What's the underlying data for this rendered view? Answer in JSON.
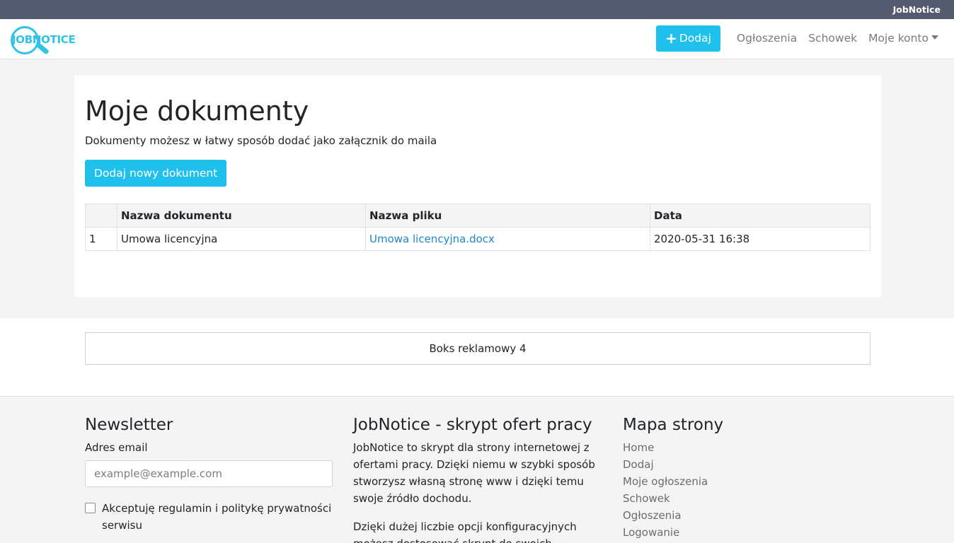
{
  "topbar": {
    "brand": "JobNotice"
  },
  "navbar": {
    "logo_text": "JOBNOTICE",
    "add_label": "Dodaj",
    "links": [
      "Ogłoszenia",
      "Schowek",
      "Moje konto"
    ]
  },
  "main": {
    "title": "Moje dokumenty",
    "subtitle": "Dokumenty możesz w łatwy sposób dodać jako załącznik do maila",
    "new_doc_button": "Dodaj nowy dokument",
    "table": {
      "headers": [
        "",
        "Nazwa dokumentu",
        "Nazwa pliku",
        "Data"
      ],
      "rows": [
        {
          "num": "1",
          "doc_name": "Umowa licencyjna",
          "file_name": "Umowa licencyjna.docx",
          "date": "2020-05-31 16:38"
        }
      ]
    }
  },
  "ad": {
    "label": "Boks reklamowy 4"
  },
  "footer": {
    "newsletter": {
      "title": "Newsletter",
      "email_label": "Adres email",
      "email_placeholder": "example@example.com",
      "consent": "Akceptuję regulamin i politykę prywatności serwisu"
    },
    "about": {
      "title": "JobNotice - skrypt ofert pracy",
      "p1": "JobNotice to skrypt dla strony internetowej z ofertami pracy. Dzięki niemu w szybki sposób stworzysz własną stronę www i dzięki temu swoje źródło dochodu.",
      "p2": "Dzięki dużej liczbie opcji konfiguracyjnych możesz dostosować skrypt do swoich"
    },
    "sitemap": {
      "title": "Mapa strony",
      "links": [
        "Home",
        "Dodaj",
        "Moje ogłoszenia",
        "Schowek",
        "Ogłoszenia",
        "Logowanie"
      ]
    }
  }
}
